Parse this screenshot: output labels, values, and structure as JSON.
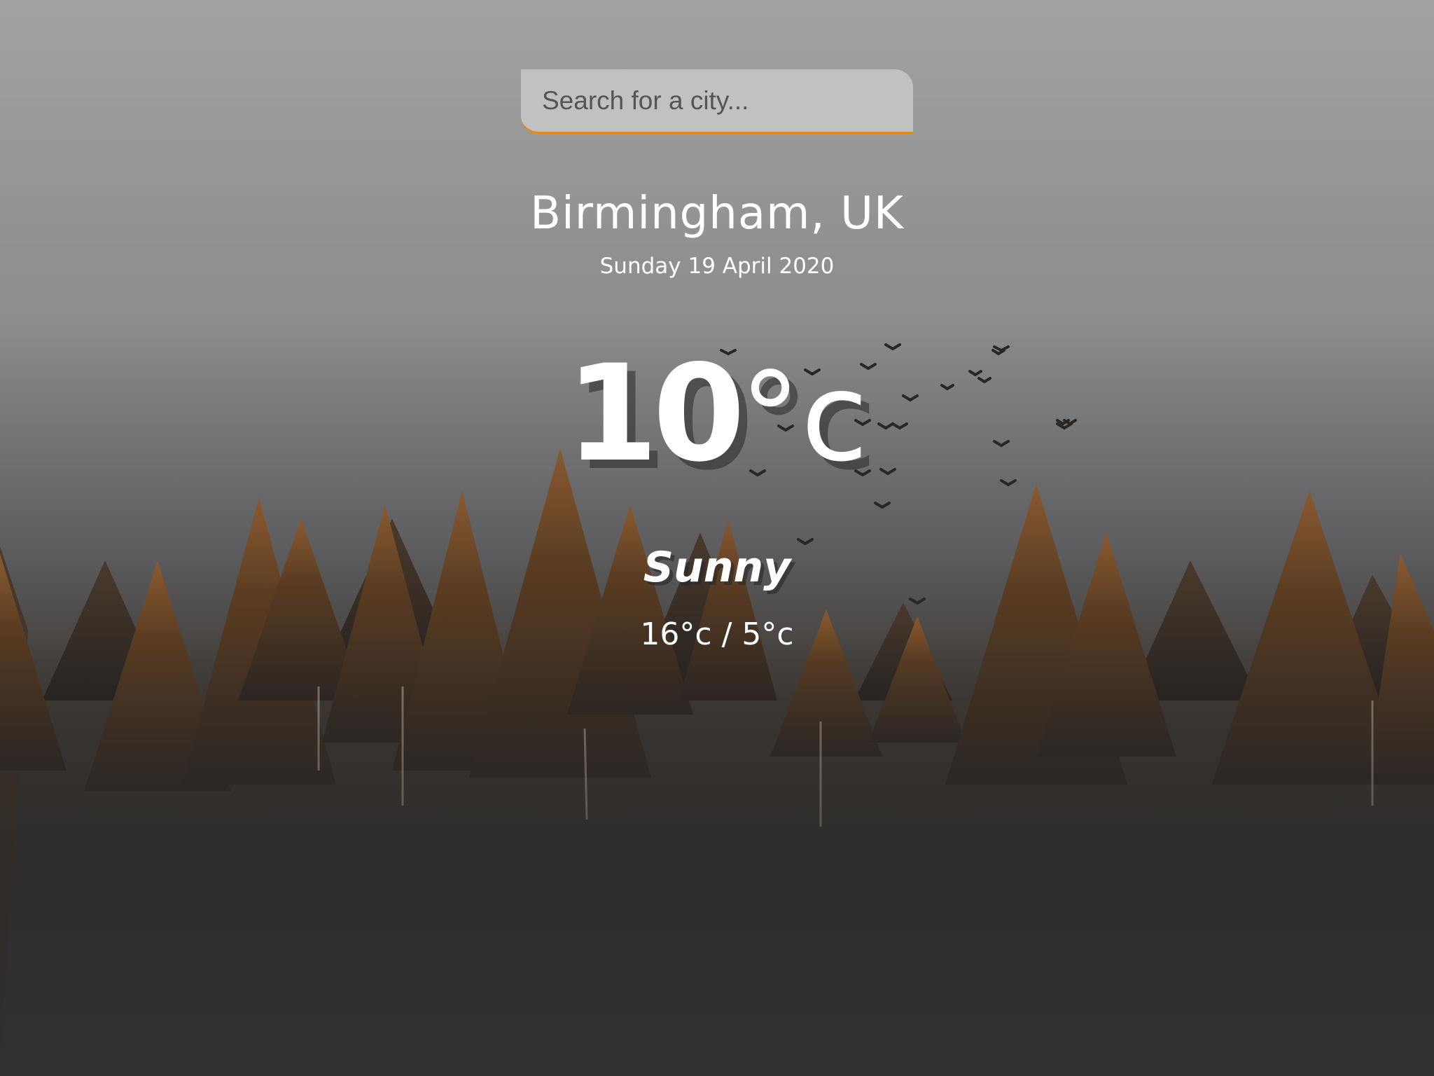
{
  "search": {
    "placeholder": "Search for a city..."
  },
  "location": {
    "name": "Birmingham, UK",
    "date": "Sunday 19 April 2020"
  },
  "current": {
    "temp_value": "10",
    "temp_unit": "°c",
    "condition": "Sunny",
    "hi_low": "16°c / 5°c"
  },
  "colors": {
    "accent": "#e28b1a",
    "text": "#ffffff"
  }
}
